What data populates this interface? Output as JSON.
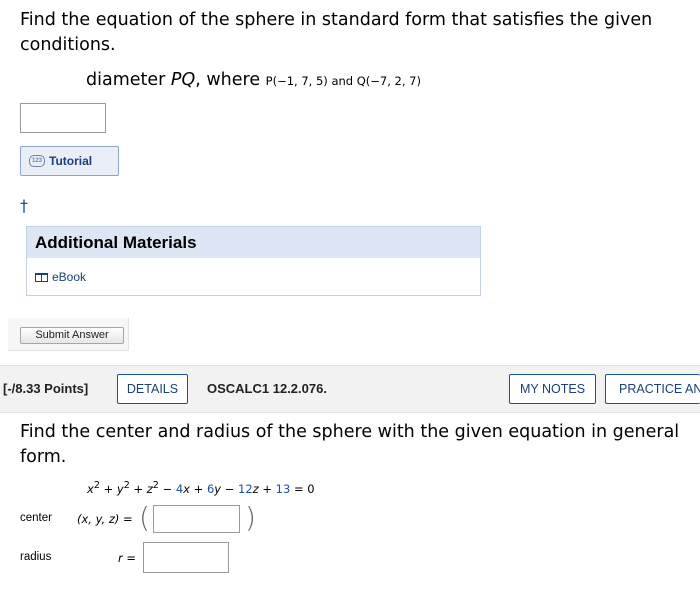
{
  "q1": {
    "prompt": "Find the equation of the sphere in standard form that satisfies the given conditions.",
    "condition_prefix": "diameter ",
    "condition_pq": "PQ",
    "condition_where": ", where ",
    "point_p": "P(−1, 7, 5)",
    "and": " and ",
    "point_q": "Q(−7, 2, 7)",
    "answer_value": "",
    "tutorial_label": "Tutorial",
    "tutorial_icon": "tutorial-icon",
    "dagger": "†",
    "additional_materials_title": "Additional Materials",
    "ebook_label": "eBook",
    "submit_label": "Submit Answer"
  },
  "q2": {
    "points": "[-/8.33 Points]",
    "details_label": "DETAILS",
    "question_id": "OSCALC1 12.2.076.",
    "my_notes_label": "MY NOTES",
    "practice_label": "PRACTICE ANOTHER",
    "prompt": "Find the center and radius of the sphere with the given equation in general form.",
    "equation": {
      "t1": "x",
      "t2": " + y",
      "t3": " + z",
      "t4": " − ",
      "c4": "4",
      "v4": "x",
      "t5": " + ",
      "c5": "6",
      "v5": "y",
      "t6": " − ",
      "c6": "12",
      "v6": "z",
      "t7": " + ",
      "c7": "13",
      "t8": " = 0",
      "sq": "2"
    },
    "center_label": "center",
    "center_tuple": "(x, y, z)",
    "equals": "=",
    "center_value": "",
    "radius_label": "radius",
    "radius_var": "r",
    "radius_value": ""
  },
  "colors": {
    "accent": "#1a4fa0",
    "header_bg": "#f2f2f2",
    "materials_bg": "#dde6f5"
  }
}
